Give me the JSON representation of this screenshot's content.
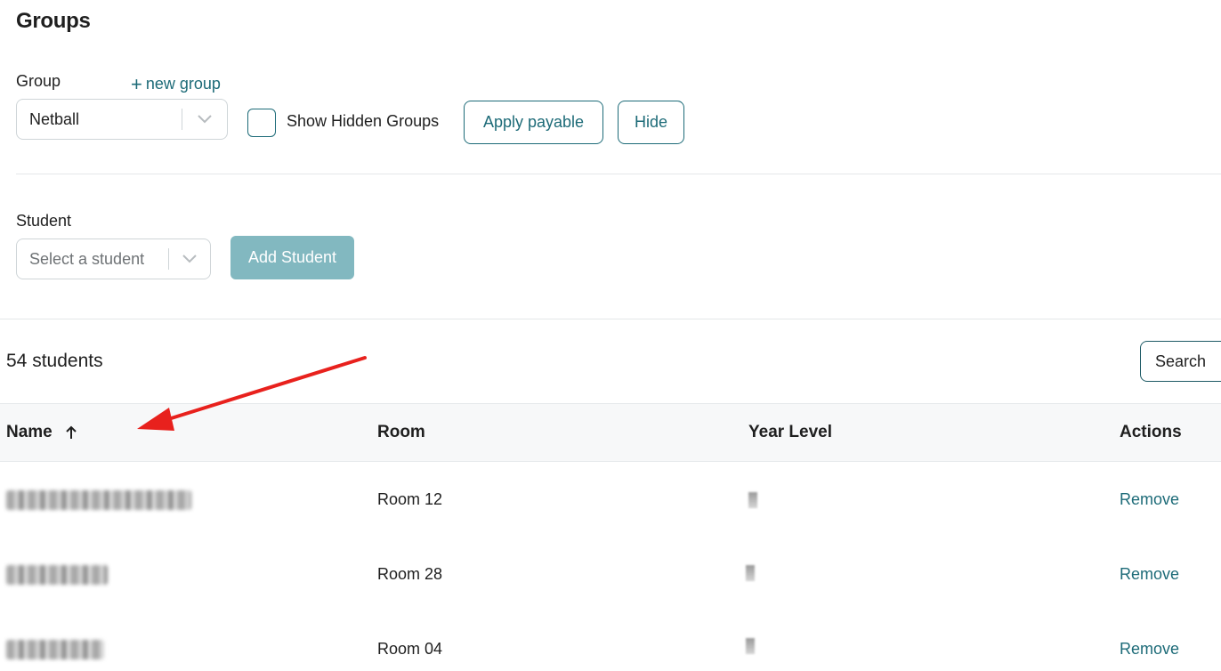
{
  "page": {
    "title": "Groups"
  },
  "group": {
    "label": "Group",
    "new_group_link": "new group",
    "selected": "Netball",
    "show_hidden_label": "Show Hidden Groups",
    "apply_payable_label": "Apply payable",
    "hide_label": "Hide"
  },
  "student": {
    "label": "Student",
    "placeholder": "Select a student",
    "add_label": "Add Student"
  },
  "list": {
    "count_text": "54 students",
    "search_label": "Search",
    "columns": {
      "name": "Name",
      "room": "Room",
      "year": "Year Level",
      "actions": "Actions"
    },
    "rows": [
      {
        "room": "Room 12",
        "action": "Remove"
      },
      {
        "room": "Room 28",
        "action": "Remove"
      },
      {
        "room": "Room 04",
        "action": "Remove"
      }
    ]
  },
  "colors": {
    "accent": "#1d6b78",
    "button_fill": "#82b8c0",
    "annotation_arrow": "#e8211d"
  }
}
